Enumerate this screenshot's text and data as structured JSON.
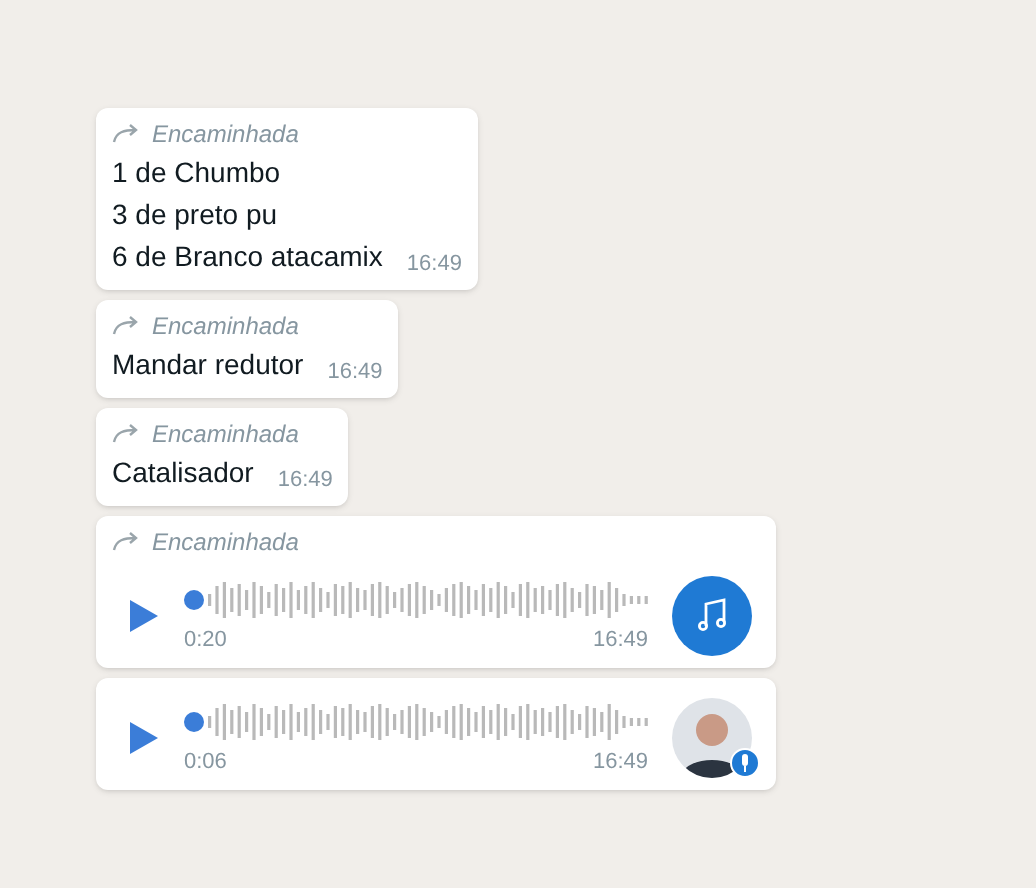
{
  "messages": [
    {
      "kind": "text",
      "forwarded": true,
      "forwarded_label": "Encaminhada",
      "lines": [
        "1 de Chumbo",
        "3 de preto pu",
        "6 de Branco atacamix"
      ],
      "time": "16:49"
    },
    {
      "kind": "text",
      "forwarded": true,
      "forwarded_label": "Encaminhada",
      "lines": [
        "Mandar redutor"
      ],
      "time": "16:49"
    },
    {
      "kind": "text",
      "forwarded": true,
      "forwarded_label": "Encaminhada",
      "lines": [
        "Catalisador"
      ],
      "time": "16:49"
    },
    {
      "kind": "audio",
      "forwarded": true,
      "forwarded_label": "Encaminhada",
      "duration": "0:20",
      "time": "16:49",
      "avatar": {
        "kind": "music"
      }
    },
    {
      "kind": "audio",
      "forwarded": false,
      "duration": "0:06",
      "time": "16:49",
      "avatar": {
        "kind": "contact"
      }
    }
  ]
}
